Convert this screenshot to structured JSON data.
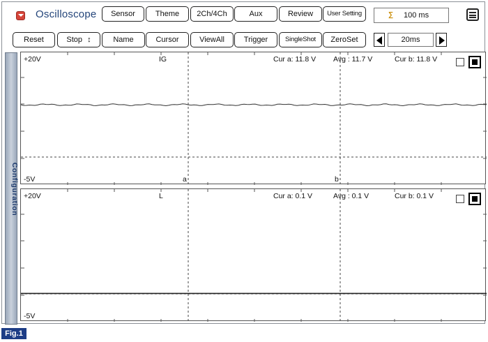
{
  "header": {
    "title": "Oscilloscope",
    "buttons": [
      "Sensor",
      "Theme",
      "2Ch/4Ch",
      "Aux",
      "Review",
      "User Setting"
    ],
    "time_base": "100 ms",
    "icons": {
      "app": "dropdown-icon",
      "time": "timebase-icon",
      "menu": "menu-icon"
    }
  },
  "toolbar": {
    "buttons": [
      "Reset",
      "Stop",
      "Name",
      "Cursor",
      "ViewAll",
      "Trigger",
      "SingleShot",
      "ZeroSet"
    ],
    "stop_selector": "↕",
    "step_value": "20ms"
  },
  "sidebar": {
    "label": "Configuration"
  },
  "channels": [
    {
      "name": "IG",
      "scale_max": "+20V",
      "scale_min": "-5V",
      "cursor_a": "Cur a: 11.8 V",
      "average": "Avg : 11.7 V",
      "cursor_b": "Cur b: 11.8 V",
      "marker_a": "a",
      "marker_b": "b",
      "level": 11.7
    },
    {
      "name": "L",
      "scale_max": "+20V",
      "scale_min": "-5V",
      "cursor_a": "Cur a: 0.1 V",
      "average": "Avg : 0.1 V",
      "cursor_b": "Cur b: 0.1 V",
      "level": 0.1
    }
  ],
  "footer": {
    "figure_label": "Fig.1"
  }
}
